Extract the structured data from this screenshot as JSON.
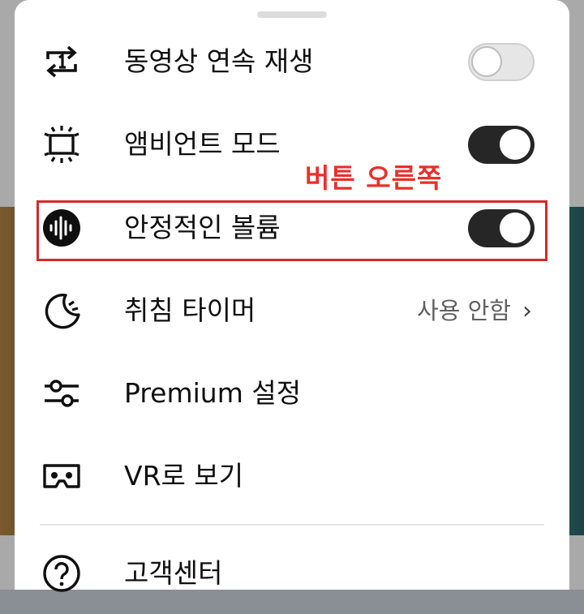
{
  "sheet": {
    "items": [
      {
        "label": "동영상 연속 재생",
        "icon": "autoplay-repeat-icon",
        "control": "toggle",
        "state": "off"
      },
      {
        "label": "앰비언트 모드",
        "icon": "ambient-mode-icon",
        "control": "toggle",
        "state": "on"
      },
      {
        "label": "안정적인 볼륨",
        "icon": "stable-volume-icon",
        "control": "toggle",
        "state": "on"
      },
      {
        "label": "취침 타이머",
        "icon": "moon-timer-icon",
        "control": "value",
        "value": "사용 안함"
      },
      {
        "label": "Premium 설정",
        "icon": "sliders-icon"
      },
      {
        "label": "VR로 보기",
        "icon": "vr-headset-icon"
      },
      {
        "label": "고객센터",
        "icon": "help-circle-icon"
      }
    ]
  },
  "annotation": {
    "text": "버튼 오른쪽",
    "color": "#e8302a"
  },
  "colors": {
    "toggle_on": "#262626",
    "toggle_off": "#e6e6e6"
  }
}
